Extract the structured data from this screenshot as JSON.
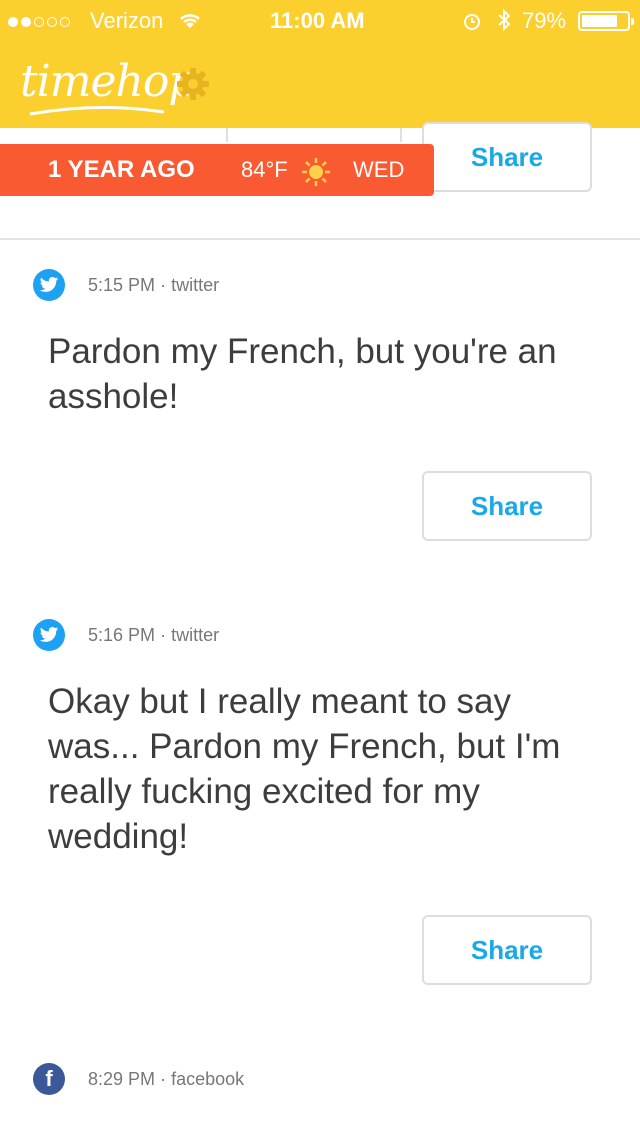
{
  "status_bar": {
    "carrier": "Verizon",
    "time": "11:00 AM",
    "battery_percent": "79%",
    "battery_level": 0.79,
    "signal_bars": 2
  },
  "header": {
    "logo_text": "timehop",
    "settings_icon": "gear-icon"
  },
  "top_card": {
    "share_label": "Share"
  },
  "banner": {
    "ago": "1 YEAR AGO",
    "temperature": "84°F",
    "weather_icon": "sun-icon",
    "day": "WED"
  },
  "posts": [
    {
      "source_icon": "twitter-icon",
      "time": "5:15 PM",
      "separator": "·",
      "source": "twitter",
      "text": "Pardon my French, but you're an asshole!",
      "share_label": "Share"
    },
    {
      "source_icon": "twitter-icon",
      "time": "5:16 PM",
      "separator": "·",
      "source": "twitter",
      "text": "Okay but I really meant to say was... Pardon my French, but I'm really fucking excited for my wedding!",
      "share_label": "Share"
    },
    {
      "source_icon": "facebook-icon",
      "time": "8:29 PM",
      "separator": "·",
      "source": "facebook",
      "icon_letter": "f"
    }
  ],
  "colors": {
    "header_bg": "#fbcf2e",
    "banner_bg": "#fa5a32",
    "share_text": "#1aa9e6",
    "twitter": "#1da1f2",
    "facebook": "#3b5998"
  }
}
